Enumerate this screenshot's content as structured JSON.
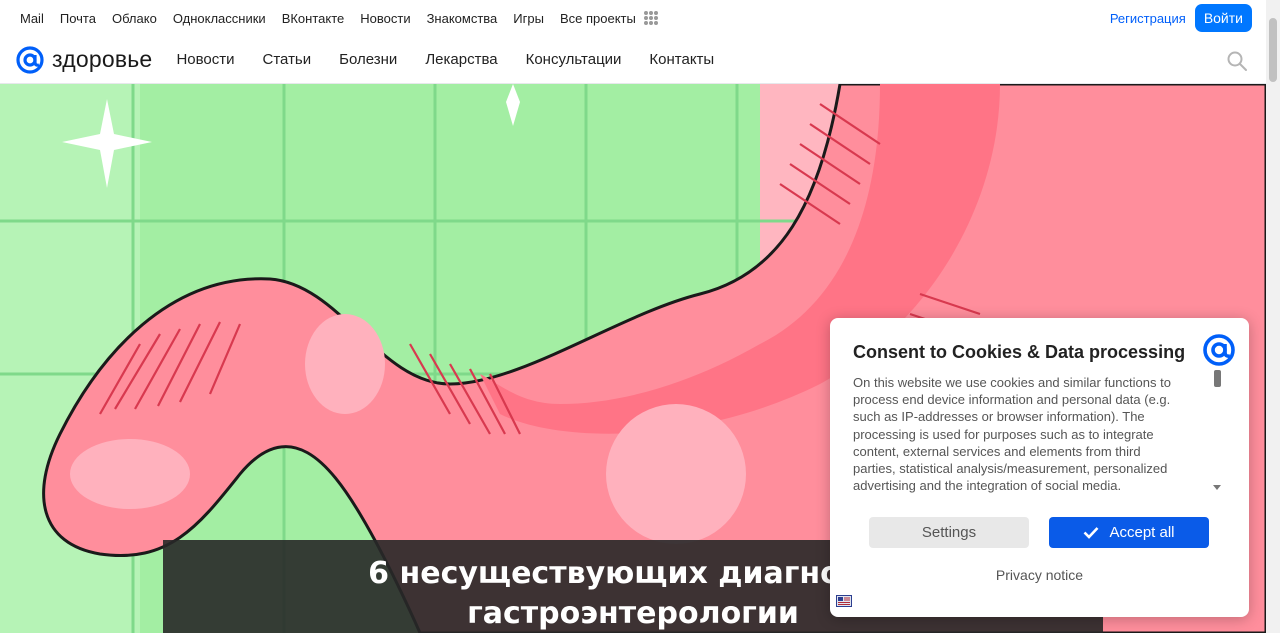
{
  "topbar": {
    "links": [
      "Mail",
      "Почта",
      "Облако",
      "Одноклассники",
      "ВКонтакте",
      "Новости",
      "Знакомства",
      "Игры",
      "Все проекты"
    ],
    "register_label": "Регистрация",
    "login_label": "Войти"
  },
  "brand": {
    "logo_text": "здоровье",
    "accent_color": "#005ff9"
  },
  "nav": {
    "items": [
      "Новости",
      "Статьи",
      "Болезни",
      "Лекарства",
      "Консультации",
      "Контакты"
    ]
  },
  "hero": {
    "title_line1": "6 несуществующих диагнозов",
    "title_line2": "гастроэнтерологии"
  },
  "consent": {
    "title": "Consent to Cookies & Data processing",
    "body": "On this website we use cookies and similar functions to process end device information and personal data (e.g. such as IP-addresses or browser information). The processing is used for purposes such as to integrate content, external services and elements from third parties, statistical analysis/measurement, personalized advertising and the integration of social media.",
    "settings_label": "Settings",
    "accept_label": "Accept all",
    "privacy_label": "Privacy notice"
  }
}
